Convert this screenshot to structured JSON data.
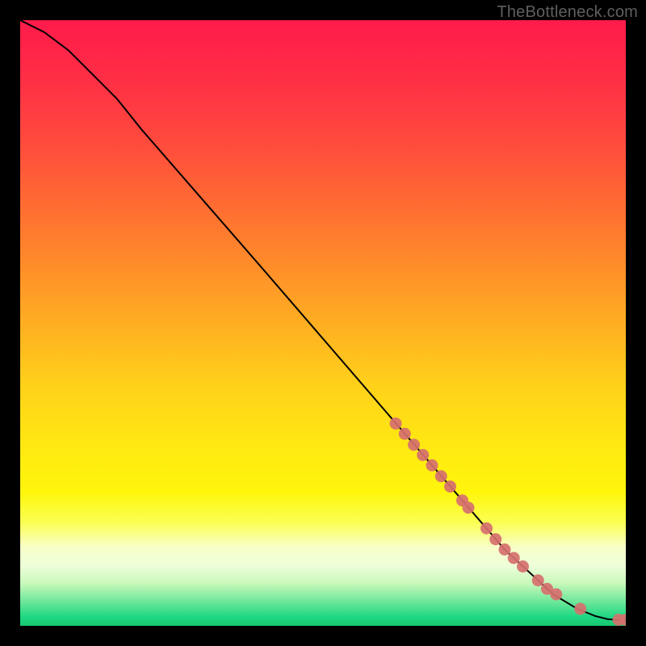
{
  "watermark": "TheBottleneck.com",
  "gradient_stops": [
    {
      "offset": 0.0,
      "color": "#ff1a4a"
    },
    {
      "offset": 0.1,
      "color": "#ff2f45"
    },
    {
      "offset": 0.2,
      "color": "#ff4a3d"
    },
    {
      "offset": 0.3,
      "color": "#ff6a33"
    },
    {
      "offset": 0.4,
      "color": "#ff8b2a"
    },
    {
      "offset": 0.5,
      "color": "#ffae22"
    },
    {
      "offset": 0.6,
      "color": "#ffd01a"
    },
    {
      "offset": 0.7,
      "color": "#ffe812"
    },
    {
      "offset": 0.78,
      "color": "#fff60c"
    },
    {
      "offset": 0.83,
      "color": "#fbff55"
    },
    {
      "offset": 0.87,
      "color": "#f8ffc8"
    },
    {
      "offset": 0.9,
      "color": "#eefeda"
    },
    {
      "offset": 0.93,
      "color": "#c8f8ba"
    },
    {
      "offset": 0.96,
      "color": "#6ee79a"
    },
    {
      "offset": 0.985,
      "color": "#1ed884"
    },
    {
      "offset": 1.0,
      "color": "#17c76f"
    }
  ],
  "chart_data": {
    "type": "line",
    "title": "",
    "xlabel": "",
    "ylabel": "",
    "xlim": [
      0,
      100
    ],
    "ylim": [
      0,
      100
    ],
    "series": [
      {
        "name": "curve",
        "x": [
          0,
          4,
          8,
          12,
          16,
          20,
          30,
          40,
          50,
          60,
          70,
          80,
          88,
          92,
          95,
          97,
          98.5,
          100
        ],
        "y": [
          100,
          98,
          95,
          91,
          87,
          82,
          70.5,
          59,
          47.4,
          35.8,
          24.2,
          12.6,
          5.2,
          2.8,
          1.6,
          1.1,
          1.0,
          1.0
        ]
      }
    ],
    "markers": {
      "name": "points",
      "x": [
        62,
        63.5,
        65,
        66.5,
        68,
        69.5,
        71,
        73,
        74,
        77,
        78.5,
        80,
        81.5,
        83,
        85.5,
        87,
        88.5,
        92.5,
        98.8,
        100
      ],
      "y": [
        33.4,
        31.7,
        29.9,
        28.2,
        26.5,
        24.7,
        23.0,
        20.7,
        19.5,
        16.1,
        14.3,
        12.6,
        11.2,
        9.8,
        7.5,
        6.1,
        5.2,
        2.8,
        1.0,
        1.0
      ]
    }
  }
}
